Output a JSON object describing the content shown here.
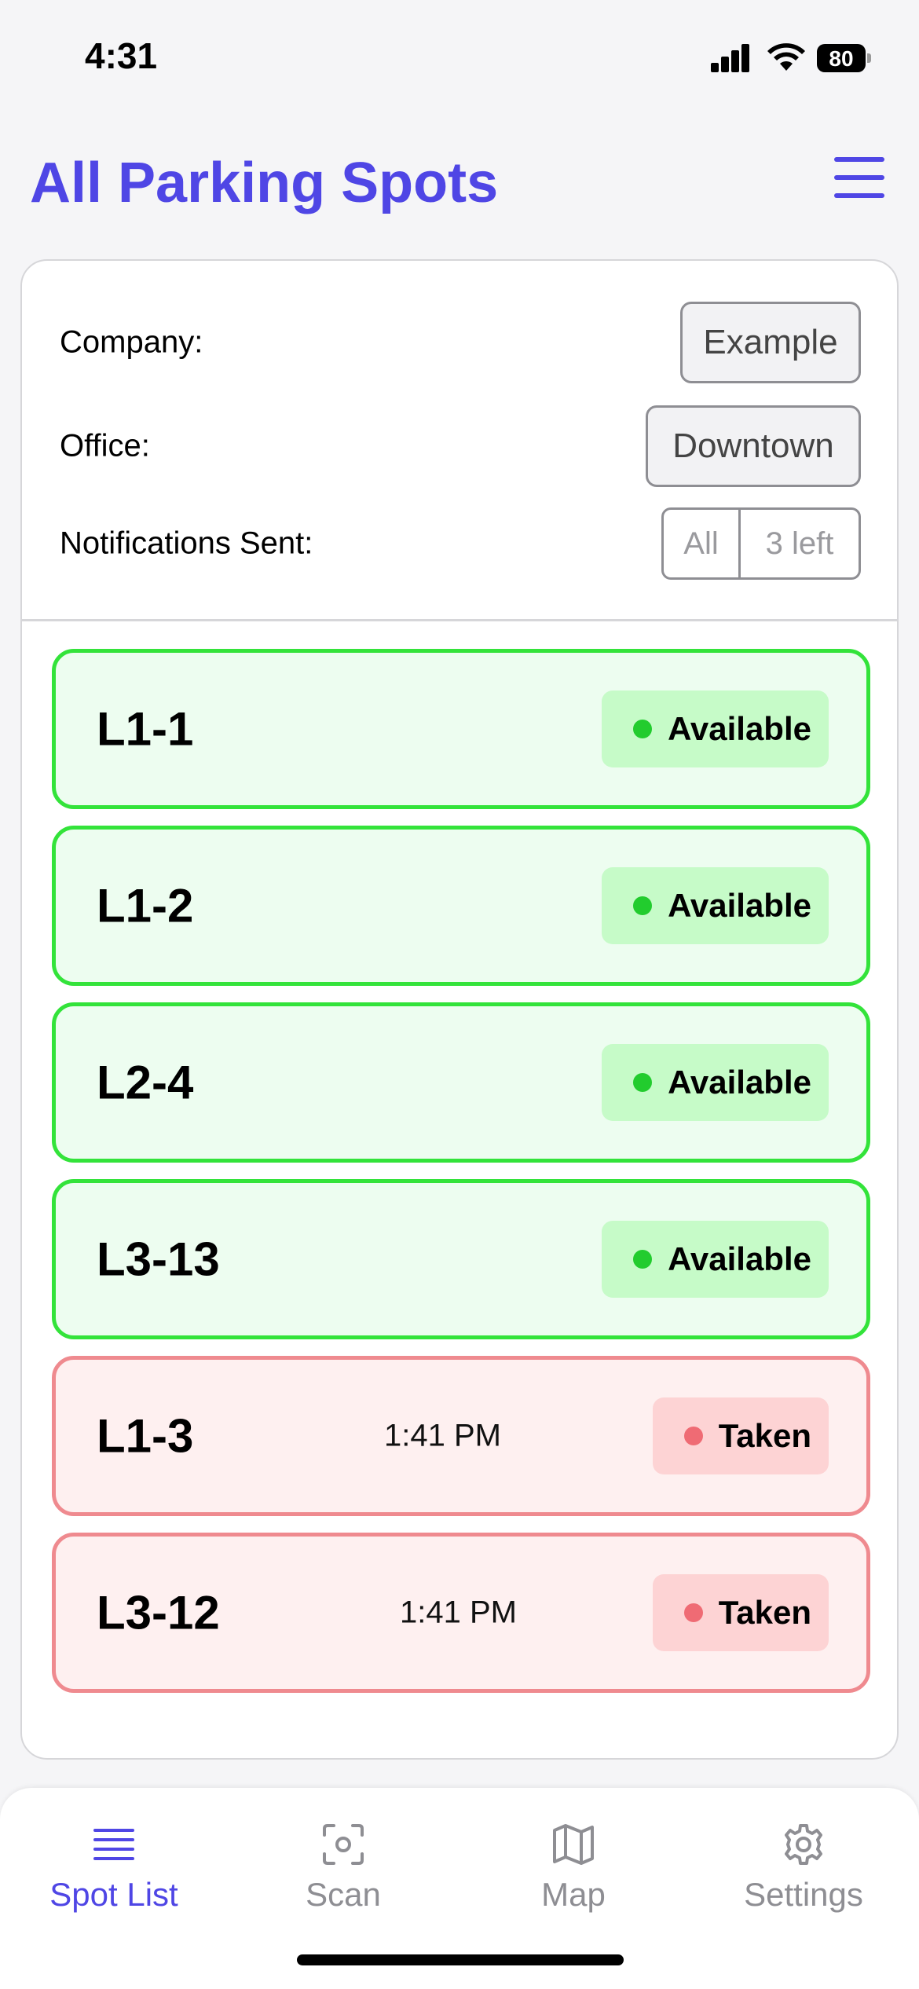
{
  "status_bar": {
    "time": "4:31",
    "battery": "80"
  },
  "header": {
    "title": "All Parking Spots",
    "menu_icon": "hamburger-menu-icon"
  },
  "filters": {
    "company": {
      "label": "Company:",
      "value": "Example"
    },
    "office": {
      "label": "Office:",
      "value": "Downtown"
    },
    "notifications": {
      "label": "Notifications Sent:",
      "options": [
        "All",
        "3 left"
      ]
    }
  },
  "spots": [
    {
      "name": "L1-1",
      "status": "Available",
      "time": ""
    },
    {
      "name": "L1-2",
      "status": "Available",
      "time": ""
    },
    {
      "name": "L2-4",
      "status": "Available",
      "time": ""
    },
    {
      "name": "L3-13",
      "status": "Available",
      "time": ""
    },
    {
      "name": "L1-3",
      "status": "Taken",
      "time": "1:41 PM"
    },
    {
      "name": "L3-12",
      "status": "Taken",
      "time": "1:41 PM"
    }
  ],
  "tabs": [
    {
      "label": "Spot List",
      "icon": "list-icon",
      "active": true
    },
    {
      "label": "Scan",
      "icon": "scan-icon",
      "active": false
    },
    {
      "label": "Map",
      "icon": "map-icon",
      "active": false
    },
    {
      "label": "Settings",
      "icon": "gear-icon",
      "active": false
    }
  ],
  "colors": {
    "accent": "#4f46e5",
    "available_border": "#33e33a",
    "available_bg": "#edfdf0",
    "taken_border": "#ef8a8f",
    "taken_bg": "#fef0f0"
  }
}
